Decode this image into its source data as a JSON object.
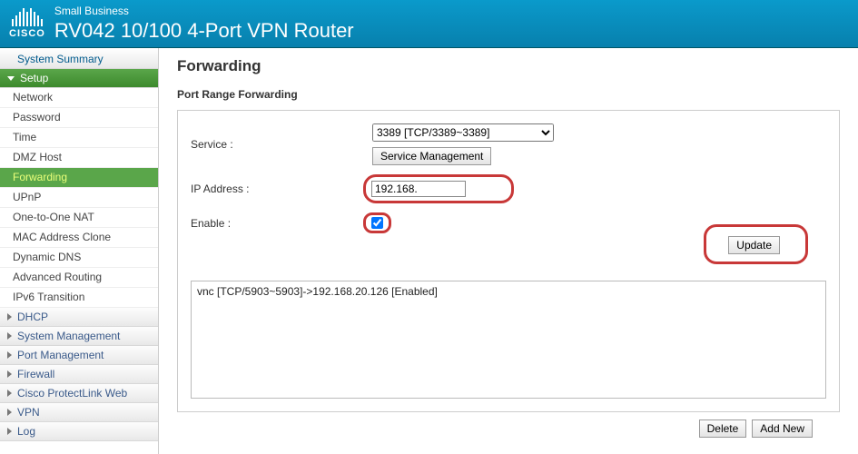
{
  "header": {
    "brand": "CISCO",
    "small_business": "Small Business",
    "model": "RV042  10/100 4-Port VPN Router"
  },
  "sidebar": {
    "top_item": "System Summary",
    "setup_label": "Setup",
    "setup_subs": [
      "Network",
      "Password",
      "Time",
      "DMZ Host",
      "Forwarding",
      "UPnP",
      "One-to-One NAT",
      "MAC Address Clone",
      "Dynamic DNS",
      "Advanced Routing",
      "IPv6 Transition"
    ],
    "collapsed": [
      "DHCP",
      "System Management",
      "Port Management",
      "Firewall",
      "Cisco ProtectLink Web",
      "VPN",
      "Log"
    ]
  },
  "page": {
    "title": "Forwarding",
    "section": "Port Range Forwarding",
    "labels": {
      "service": "Service :",
      "ip": "IP Address :",
      "enable": "Enable :"
    },
    "service_selected": "3389 [TCP/3389~3389]",
    "svc_mgmt_btn": "Service Management",
    "ip_value": "192.168.",
    "enable_checked": true,
    "update_btn": "Update",
    "list_entries": [
      "vnc [TCP/5903~5903]->192.168.20.126 [Enabled]"
    ],
    "delete_btn": "Delete",
    "addnew_btn": "Add New"
  }
}
